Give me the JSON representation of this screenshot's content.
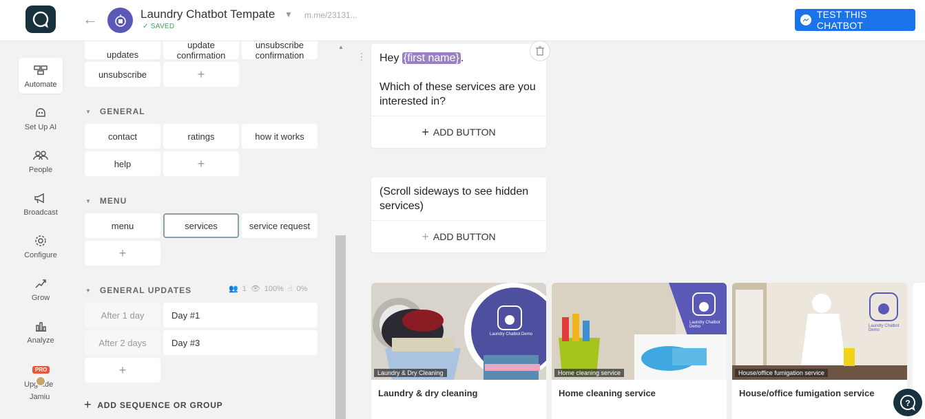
{
  "header": {
    "bot_title": "Laundry Chatbot Tempate",
    "saved_label": "SAVED",
    "bot_link": "m.me/23131...",
    "test_button": "TEST THIS CHATBOT"
  },
  "nav": {
    "items": [
      {
        "label": "Automate",
        "icon": "automate-icon",
        "active": true
      },
      {
        "label": "Set Up AI",
        "icon": "ai-icon"
      },
      {
        "label": "People",
        "icon": "people-icon"
      },
      {
        "label": "Broadcast",
        "icon": "megaphone-icon"
      },
      {
        "label": "Configure",
        "icon": "gear-icon"
      },
      {
        "label": "Grow",
        "icon": "grow-icon"
      },
      {
        "label": "Analyze",
        "icon": "chart-icon"
      }
    ],
    "pro_badge": "PRO",
    "upgrade_label": "Upgrade",
    "user_name": "Jamiu"
  },
  "panel": {
    "top_keywords": [
      "updates",
      "update confirmation",
      "unsubscribe confirmation",
      "unsubscribe"
    ],
    "general": {
      "title": "GENERAL",
      "keywords": [
        "contact",
        "ratings",
        "how it works",
        "help"
      ]
    },
    "menu": {
      "title": "MENU",
      "keywords": [
        "menu",
        "services",
        "service request"
      ],
      "selected": "services"
    },
    "general_updates": {
      "title": "GENERAL UPDATES",
      "stats": {
        "subscribers": "1",
        "open_rate": "100%",
        "click_rate": "0%"
      },
      "steps": [
        {
          "delay": "After 1 day",
          "message": "Day #1"
        },
        {
          "delay": "After 2 days",
          "message": "Day #3"
        }
      ]
    },
    "add_sequence_label": "ADD SEQUENCE OR GROUP"
  },
  "canvas": {
    "message1": {
      "greeting": "Hey ",
      "variable": "{first name}",
      "greeting_end": ".",
      "question": "Which of these services are you interested in?",
      "add_button": "ADD BUTTON"
    },
    "message2": {
      "text": "(Scroll sideways to see hidden services)",
      "add_button": "ADD BUTTON"
    },
    "gallery": [
      {
        "caption": "Laundry & Dry Cleaning",
        "title": "Laundry & dry cleaning",
        "brand": "Laundry Chatbot Demo"
      },
      {
        "caption": "Home cleaning service",
        "title": "Home cleaning service",
        "brand": "Laundry Chatbot Demo"
      },
      {
        "caption": "House/office fumigation service",
        "title": "House/office fumigation service",
        "brand": "Laundry Chatbot Demo"
      }
    ]
  },
  "colors": {
    "accent": "#1a73e8",
    "logo_bg": "#17323d",
    "variable_chip": "#9a80c4",
    "saved_green": "#3aa35a"
  }
}
